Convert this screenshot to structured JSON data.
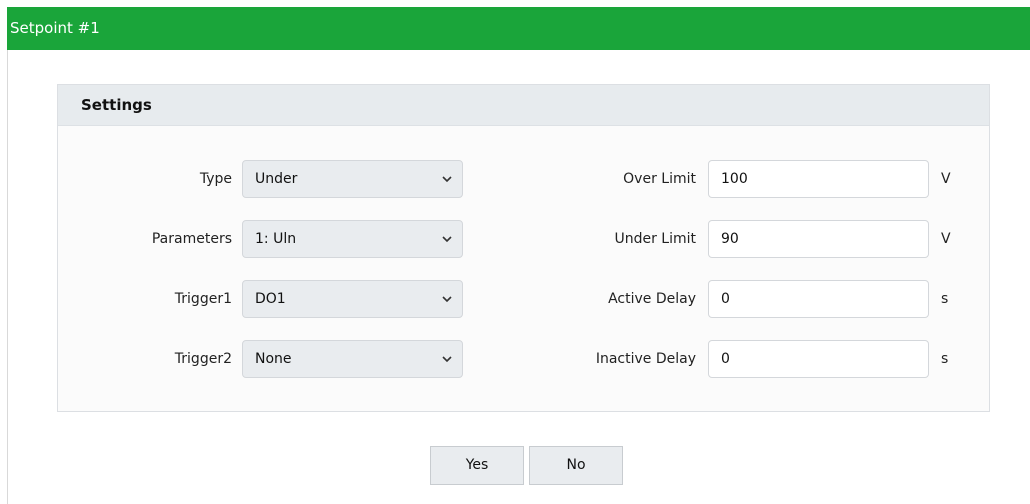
{
  "window": {
    "title": "Setpoint #1"
  },
  "panel": {
    "title": "Settings"
  },
  "left_fields": [
    {
      "label": "Type",
      "value": "Under"
    },
    {
      "label": "Parameters",
      "value": "1: Uln"
    },
    {
      "label": "Trigger1",
      "value": "DO1"
    },
    {
      "label": "Trigger2",
      "value": "None"
    }
  ],
  "right_fields": [
    {
      "label": "Over Limit",
      "value": "100",
      "unit": "V"
    },
    {
      "label": "Under Limit",
      "value": "90",
      "unit": "V"
    },
    {
      "label": "Active Delay",
      "value": "0",
      "unit": "s"
    },
    {
      "label": "Inactive Delay",
      "value": "0",
      "unit": "s"
    }
  ],
  "buttons": {
    "yes_label": "Yes",
    "no_label": "No"
  },
  "icons": {
    "select_arrow": "chevron-down-icon"
  },
  "colors": {
    "titlebar": "#1aa53a",
    "panel_header": "#e7ebee",
    "select_bg": "#e9ecef"
  }
}
